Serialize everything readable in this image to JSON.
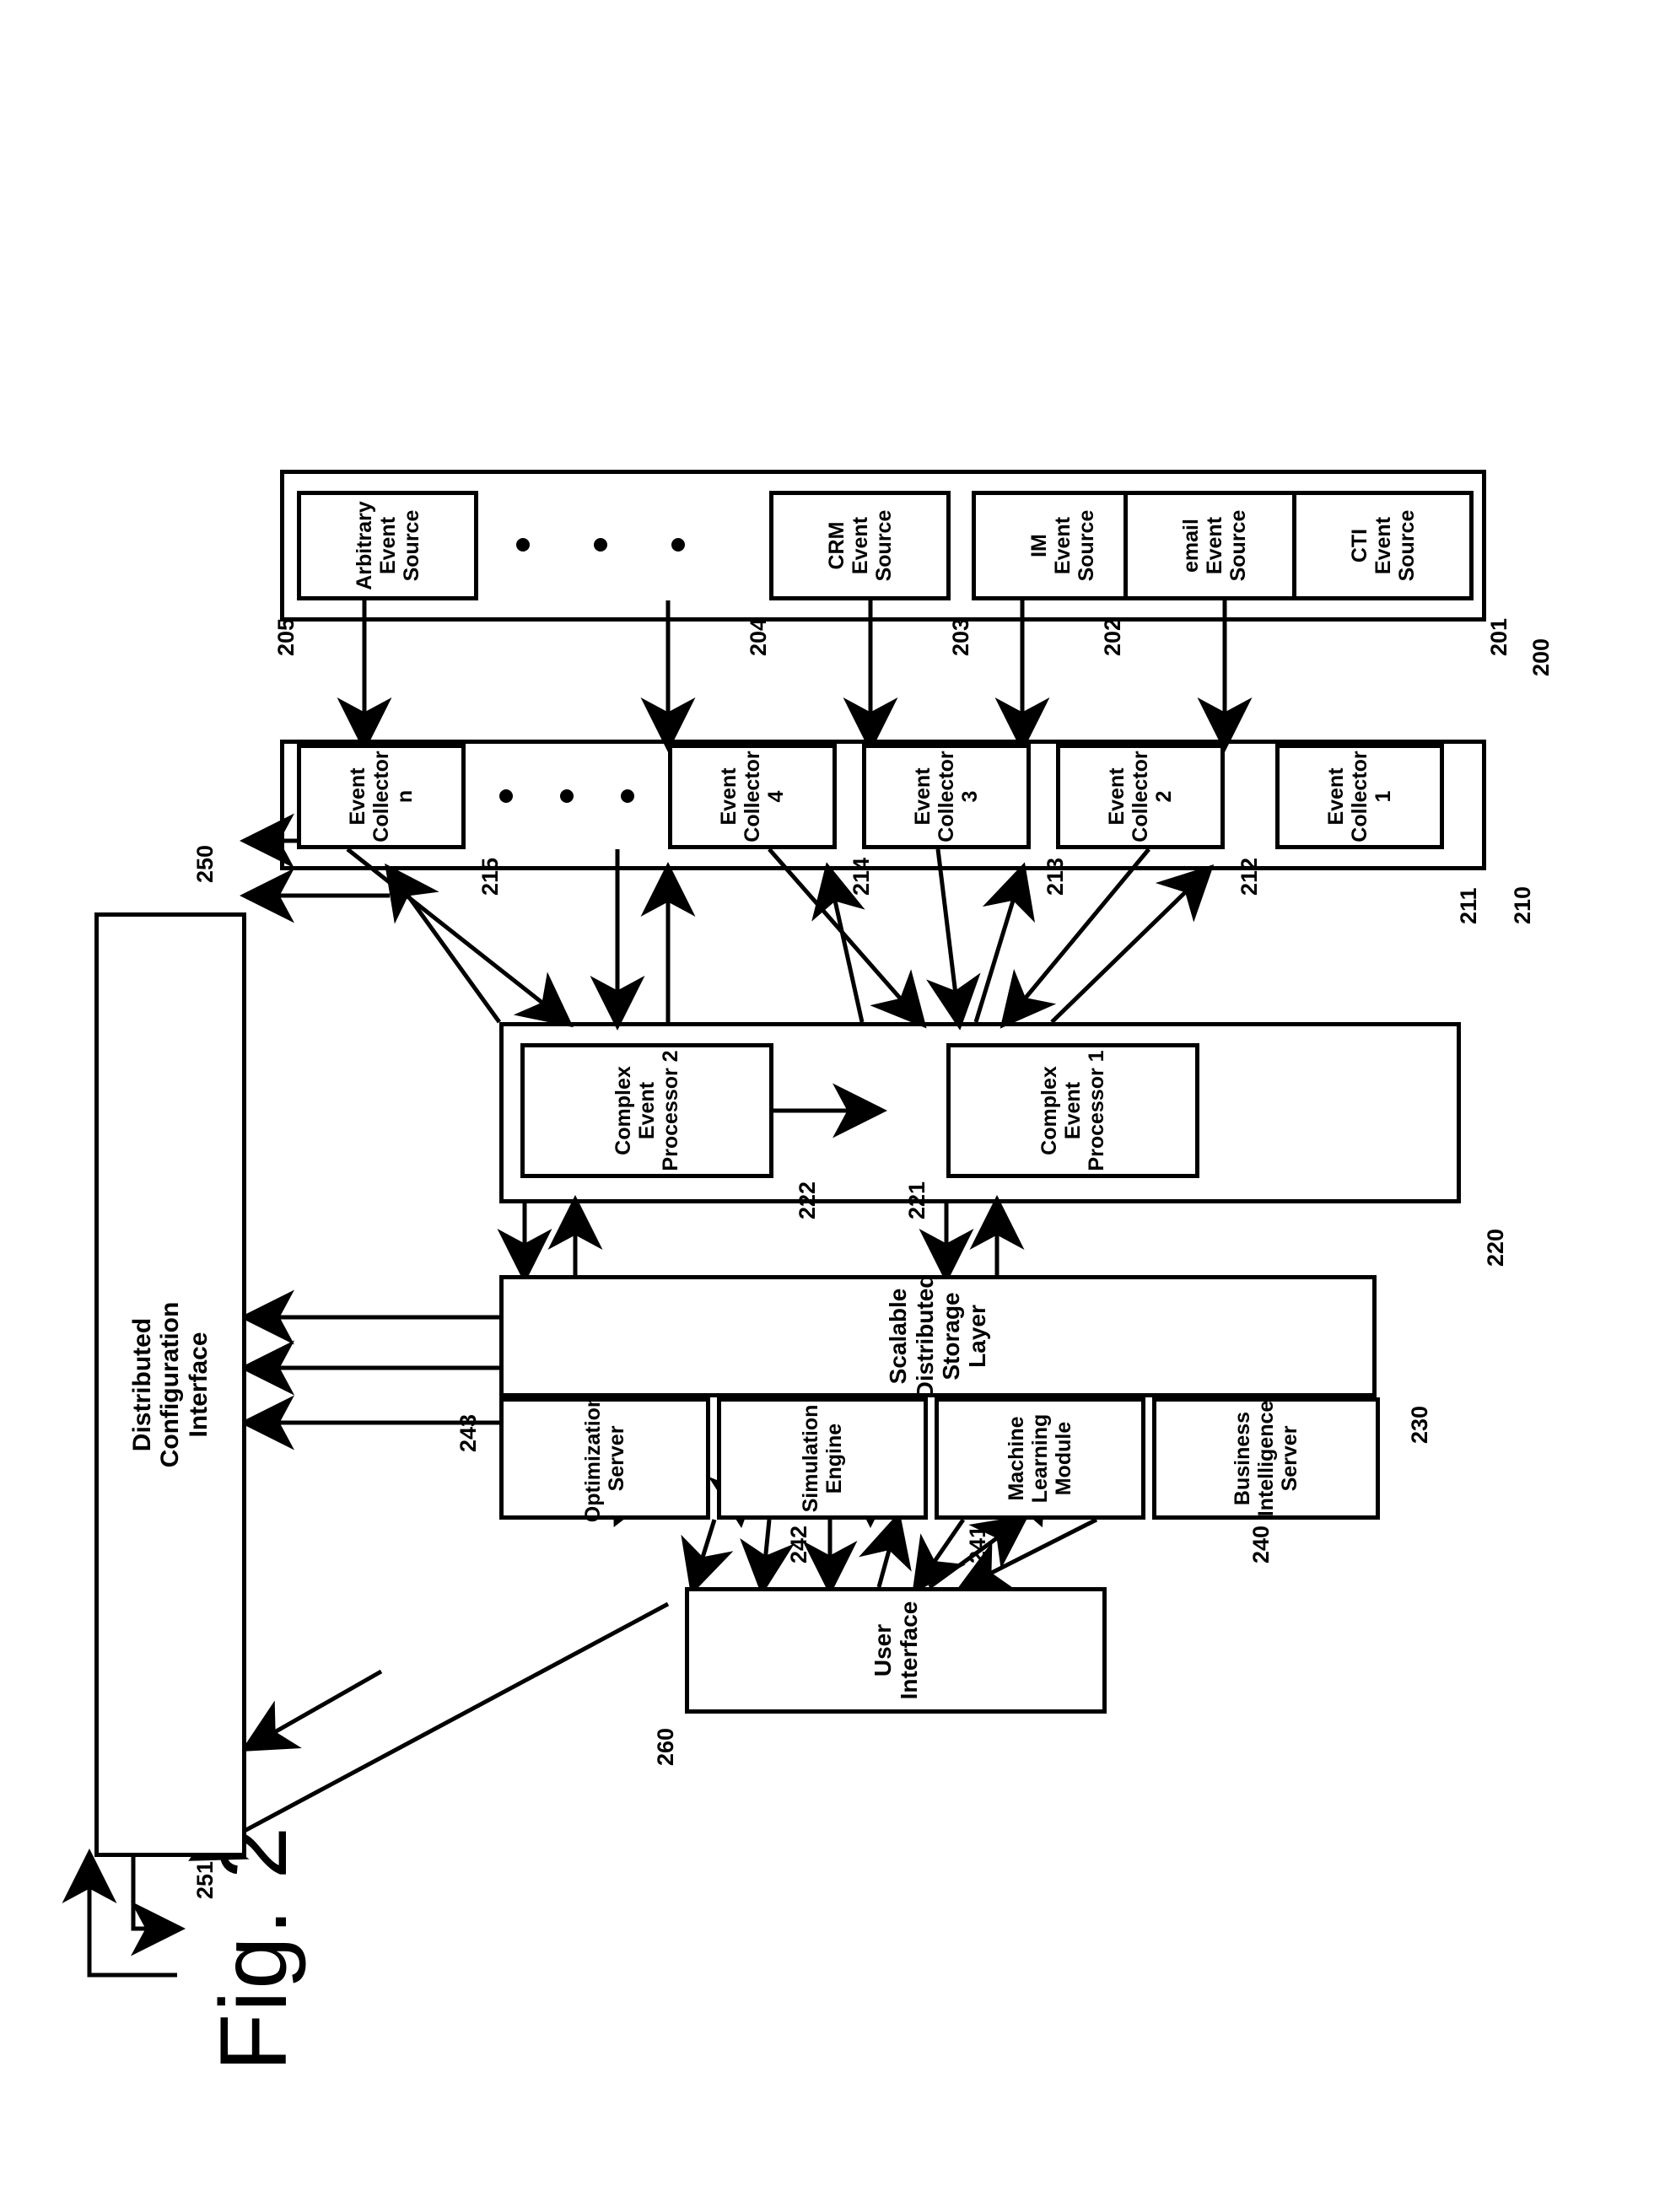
{
  "figure": {
    "label": "Fig. 2",
    "type": "patent-block-diagram"
  },
  "boxes": {
    "configuration_interface": {
      "label": "Configuration\nInterface",
      "ref": "251"
    },
    "distributed_configuration_interface": {
      "label": "Distributed\nConfiguration\nInterface",
      "ref": "250"
    },
    "user_interface": {
      "label": "User Interface",
      "ref": "260"
    },
    "business_intelligence_server": {
      "label": "Business\nIntelligence\nServer",
      "ref": "240"
    },
    "machine_learning_module": {
      "label": "Machine\nLearning\nModule",
      "ref": "241"
    },
    "simulation_engine": {
      "label": "Simulation\nEngine",
      "ref": "242"
    },
    "optimization_server": {
      "label": "Optimization\nServer",
      "ref": "243"
    },
    "storage_layer": {
      "label": "Scalable Distributed Storage Layer",
      "ref": "230"
    },
    "complex_event_processor_1": {
      "label": "Complex\nEvent\nProcessor 1",
      "ref": "221"
    },
    "complex_event_processor_2": {
      "label": "Complex\nEvent\nProcessor 2",
      "ref": "222"
    },
    "cep_group": {
      "ref": "220"
    },
    "collector_group": {
      "ref": "210"
    },
    "source_group": {
      "ref": "200"
    }
  },
  "event_collectors": [
    {
      "label": "Event\nCollector 1",
      "ref": "211"
    },
    {
      "label": "Event\nCollector 2",
      "ref": "212"
    },
    {
      "label": "Event\nCollector 3",
      "ref": "213"
    },
    {
      "label": "Event\nCollector 4",
      "ref": "214"
    },
    {
      "label": "Event\nCollector n",
      "ref": "215"
    }
  ],
  "event_sources": [
    {
      "label": "CTI\nEvent\nSource",
      "ref": "201"
    },
    {
      "label": "email\nEvent\nSource",
      "ref": "202"
    },
    {
      "label": "IM\nEvent\nSource",
      "ref": "203"
    },
    {
      "label": "CRM\nEvent\nSource",
      "ref": "204"
    },
    {
      "label": "Arbitrary\nEvent\nSource",
      "ref": "205"
    }
  ],
  "ellipsis": {
    "glyph": "•",
    "count": 3
  },
  "colors": {
    "ink": "#000000",
    "paper": "#ffffff"
  }
}
